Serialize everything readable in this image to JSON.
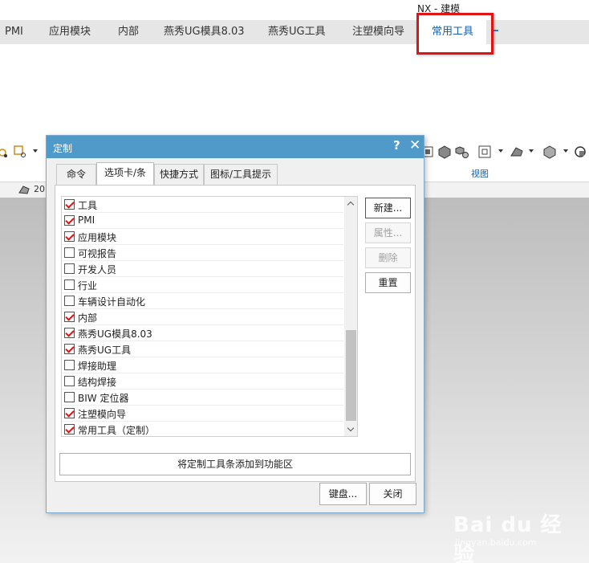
{
  "app": {
    "title": "NX - 建模"
  },
  "ribbon": {
    "tabs": [
      {
        "label": "PMI"
      },
      {
        "label": "应用模块"
      },
      {
        "label": "内部"
      },
      {
        "label": "燕秀UG模具8.03"
      },
      {
        "label": "燕秀UG工具"
      },
      {
        "label": "注塑模向导"
      },
      {
        "label": "常用工具"
      }
    ],
    "active_tab": "常用工具",
    "group_label": "视图",
    "status_number": "20"
  },
  "dialog": {
    "title": "定制",
    "help_glyph": "?",
    "close_glyph": "✕",
    "tabs": [
      "命令",
      "选项卡/条",
      "快捷方式",
      "图标/工具提示"
    ],
    "active_tab": "选项卡/条",
    "items": [
      {
        "label": "工具",
        "checked": true
      },
      {
        "label": "PMI",
        "checked": true
      },
      {
        "label": "应用模块",
        "checked": true
      },
      {
        "label": "可视报告",
        "checked": false
      },
      {
        "label": "开发人员",
        "checked": false
      },
      {
        "label": "行业",
        "checked": false
      },
      {
        "label": "车辆设计自动化",
        "checked": false
      },
      {
        "label": "内部",
        "checked": true
      },
      {
        "label": "燕秀UG模具8.03",
        "checked": true
      },
      {
        "label": "燕秀UG工具",
        "checked": true
      },
      {
        "label": "焊接助理",
        "checked": false
      },
      {
        "label": "结构焊接",
        "checked": false
      },
      {
        "label": "BIW 定位器",
        "checked": false
      },
      {
        "label": "注塑模向导",
        "checked": true
      },
      {
        "label": "常用工具（定制）",
        "checked": true
      }
    ],
    "buttons": {
      "new": "新建...",
      "properties": "属性...",
      "delete": "删除",
      "reset": "重置",
      "add_to_ribbon": "将定制工具条添加到功能区",
      "keyboard": "键盘...",
      "close": "关闭"
    }
  },
  "watermark": {
    "brand": "Bai du 经验",
    "url": "jingyan.baidu.com"
  },
  "colors": {
    "accent": "#4f9ac9",
    "highlight": "#e01414",
    "check": "#d01818"
  }
}
